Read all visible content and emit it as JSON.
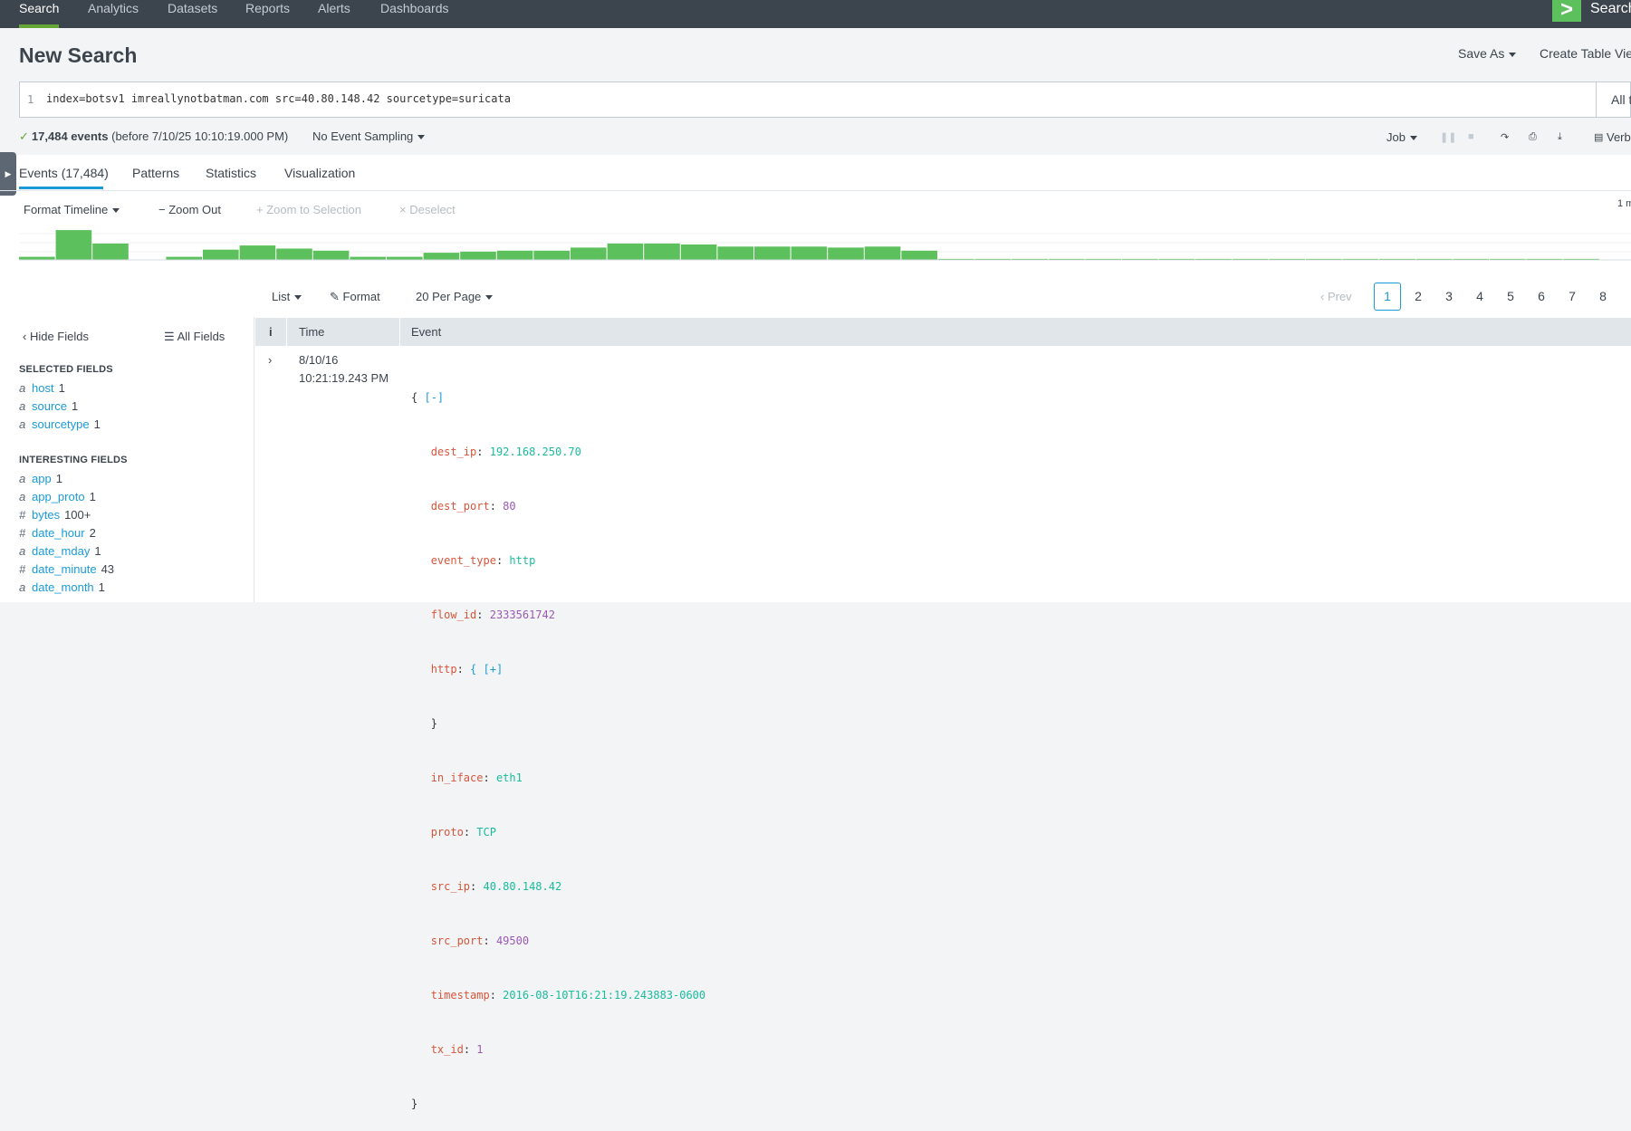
{
  "topnav": {
    "tabs": [
      "Search",
      "Analytics",
      "Datasets",
      "Reports",
      "Alerts",
      "Dashboards"
    ],
    "app_logo": ">",
    "app_name": "Search"
  },
  "header": {
    "title": "New Search",
    "save_as": "Save As",
    "create_table_view": "Create Table Vie"
  },
  "search": {
    "line_number": "1",
    "query": "index=botsv1 imreallynotbatman.com src=40.80.148.42 sourcetype=suricata",
    "time_picker": "All ti"
  },
  "status": {
    "check": "✓",
    "count": "17,484 events",
    "before": "(before 7/10/25 10:10:19.000 PM)",
    "sampling": "No Event Sampling",
    "job": "Job",
    "verbose": "Verb"
  },
  "tabs": [
    "Events (17,484)",
    "Patterns",
    "Statistics",
    "Visualization"
  ],
  "timeline_tools": {
    "format": "Format Timeline",
    "zoom_out": "Zoom Out",
    "zoom_sel": "Zoom to Selection",
    "deselect": "Deselect",
    "scale_right": "1 m"
  },
  "timeline_values": [
    3,
    29,
    16,
    0,
    3,
    10,
    14,
    11,
    9,
    3,
    3,
    7,
    8,
    9,
    9,
    12,
    16,
    16,
    15,
    13,
    13,
    13,
    12,
    13,
    9,
    1,
    1,
    1,
    1,
    1,
    1,
    1,
    1,
    1,
    1,
    1,
    1,
    1,
    1,
    1,
    1,
    1,
    1,
    0,
    0
  ],
  "results_bar": {
    "list": "List",
    "format": "Format",
    "per_page": "20 Per Page",
    "prev": "Prev",
    "pages": [
      "1",
      "2",
      "3",
      "4",
      "5",
      "6",
      "7",
      "8"
    ],
    "current_page": "1"
  },
  "fields": {
    "hide": "Hide Fields",
    "all": "All Fields",
    "selected_title": "SELECTED FIELDS",
    "selected": [
      {
        "type": "a",
        "name": "host",
        "count": "1"
      },
      {
        "type": "a",
        "name": "source",
        "count": "1"
      },
      {
        "type": "a",
        "name": "sourcetype",
        "count": "1"
      }
    ],
    "interesting_title": "INTERESTING FIELDS",
    "interesting": [
      {
        "type": "a",
        "name": "app",
        "count": "1"
      },
      {
        "type": "a",
        "name": "app_proto",
        "count": "1"
      },
      {
        "type": "#",
        "name": "bytes",
        "count": "100+"
      },
      {
        "type": "#",
        "name": "date_hour",
        "count": "2"
      },
      {
        "type": "a",
        "name": "date_mday",
        "count": "1"
      },
      {
        "type": "#",
        "name": "date_minute",
        "count": "43"
      },
      {
        "type": "a",
        "name": "date_month",
        "count": "1"
      }
    ]
  },
  "table": {
    "col_info": "i",
    "col_time": "Time",
    "col_event": "Event"
  },
  "event": {
    "expander": "›",
    "date": "8/10/16",
    "time": "10:21:19.243 PM",
    "open": "{",
    "collapse": "[-]",
    "close": "}",
    "fields": [
      {
        "key": "dest_ip",
        "value": "192.168.250.70",
        "kind": "s"
      },
      {
        "key": "dest_port",
        "value": "80",
        "kind": "n"
      },
      {
        "key": "event_type",
        "value": "http",
        "kind": "s"
      },
      {
        "key": "flow_id",
        "value": "2333561742",
        "kind": "n"
      },
      {
        "key": "http",
        "value": "{ [+]",
        "kind": "b"
      },
      {
        "key": "",
        "value": "}",
        "kind": "p"
      },
      {
        "key": "in_iface",
        "value": "eth1",
        "kind": "s"
      },
      {
        "key": "proto",
        "value": "TCP",
        "kind": "s"
      },
      {
        "key": "src_ip",
        "value": "40.80.148.42",
        "kind": "s"
      },
      {
        "key": "src_port",
        "value": "49500",
        "kind": "n"
      },
      {
        "key": "timestamp",
        "value": "2016-08-10T16:21:19.243883-0600",
        "kind": "s"
      },
      {
        "key": "tx_id",
        "value": "1",
        "kind": "n"
      }
    ]
  },
  "colors": {
    "nav_bg": "#3c444d",
    "accent_green": "#65a637",
    "timeline_green": "#5cc05c",
    "link_blue": "#1a9bd7"
  }
}
